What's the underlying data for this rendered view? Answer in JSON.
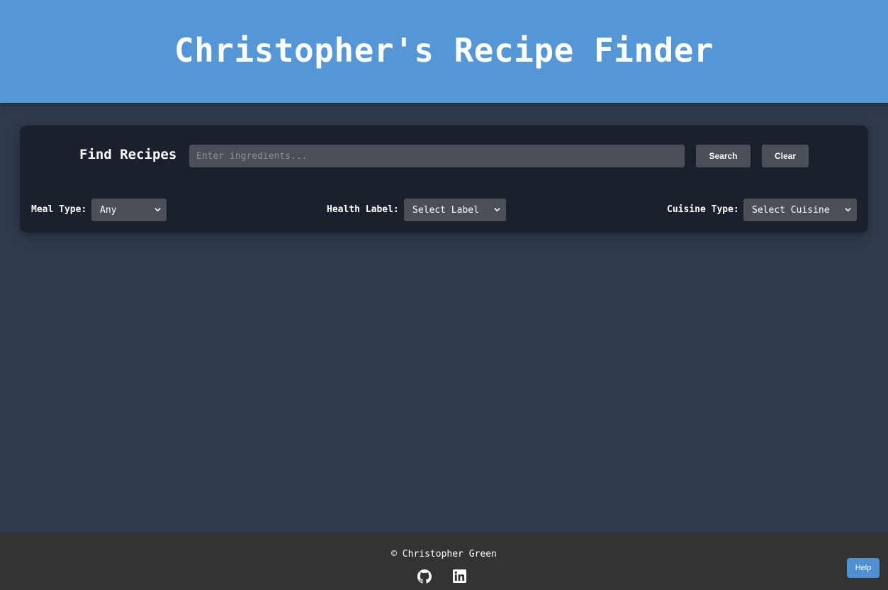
{
  "header": {
    "title": "Christopher's Recipe Finder"
  },
  "search": {
    "heading": "Find Recipes",
    "placeholder": "Enter ingredients...",
    "value": "",
    "search_label": "Search",
    "clear_label": "Clear"
  },
  "filters": {
    "meal_type": {
      "label": "Meal Type:",
      "selected": "Any"
    },
    "health_label": {
      "label": "Health Label:",
      "selected": "Select Label"
    },
    "cuisine_type": {
      "label": "Cuisine Type:",
      "selected": "Select Cuisine"
    }
  },
  "footer": {
    "copyright": "© Christopher Green",
    "links": [
      {
        "icon": "github-icon"
      },
      {
        "icon": "linkedin-icon"
      }
    ]
  },
  "help": {
    "label": "Help"
  },
  "colors": {
    "header_bg": "#5596d6",
    "page_bg": "#2f3b4d",
    "panel_bg": "#1a202c",
    "control_bg": "#4a4f58",
    "footer_bg": "#333333",
    "help_bg": "#4f90d2"
  }
}
